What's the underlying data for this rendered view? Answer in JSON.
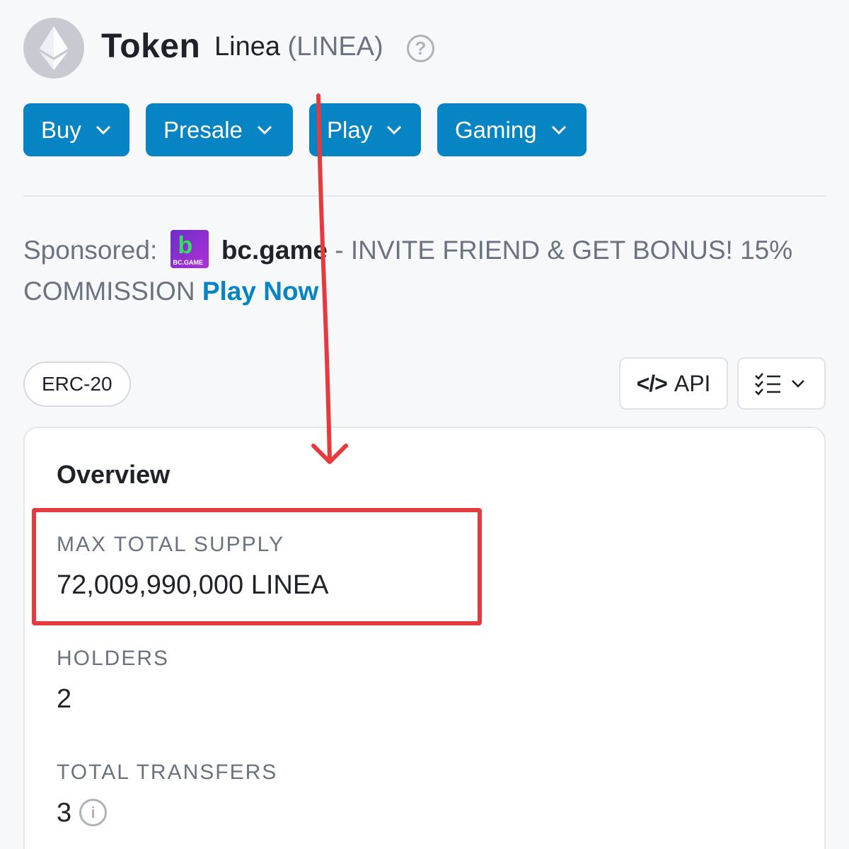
{
  "header": {
    "title": "Token",
    "token_name": "Linea",
    "token_symbol": "(LINEA)",
    "help_glyph": "?"
  },
  "nav": {
    "buy": "Buy",
    "presale": "Presale",
    "play": "Play",
    "gaming": "Gaming"
  },
  "sponsored": {
    "prefix": "Sponsored:",
    "logo_text": "BC.GAME",
    "brand": "bc.game",
    "message": " - INVITE FRIEND & GET BONUS! 15% COMMISSION ",
    "cta": "Play Now"
  },
  "badge": "ERC-20",
  "api_button": {
    "code": "</>",
    "label": "API"
  },
  "overview": {
    "title": "Overview",
    "max_supply_label": "MAX TOTAL SUPPLY",
    "max_supply_value": "72,009,990,000 LINEA",
    "holders_label": "HOLDERS",
    "holders_value": "2",
    "transfers_label": "TOTAL TRANSFERS",
    "transfers_value": "3",
    "info_glyph": "i"
  },
  "colors": {
    "brand_blue": "#0784c3",
    "annotation_red": "#e53b3f",
    "muted": "#6b7280"
  }
}
